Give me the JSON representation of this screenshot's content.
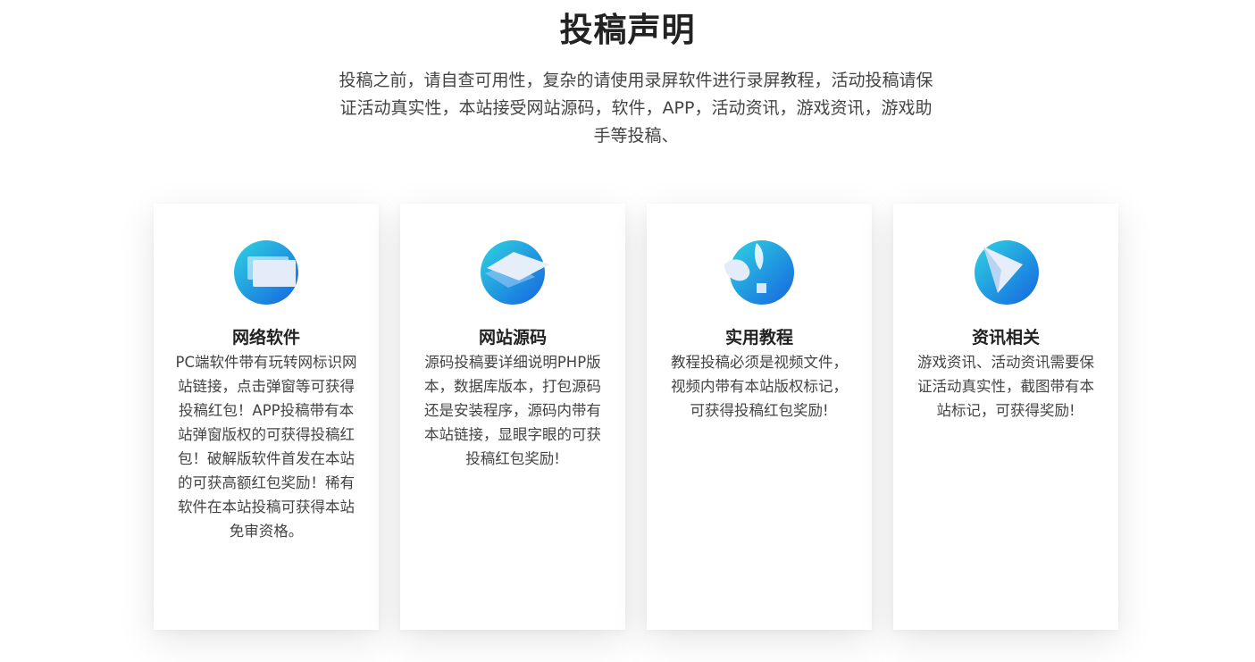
{
  "header": {
    "title": "投稿声明",
    "intro": "投稿之前，请自查可用性，复杂的请使用录屏软件进行录屏教程，活动投稿请保证活动真实性，本站接受网站源码，软件，APP，活动资讯，游戏资讯，游戏助手等投稿、"
  },
  "cards": [
    {
      "title": "网络软件",
      "description": "PC端软件带有玩转网标识网站链接，点击弹窗等可获得投稿红包！APP投稿带有本站弹窗版权的可获得投稿红包！破解版软件首发在本站的可获高额红包奖励！稀有软件在本站投稿可获得本站免审资格。",
      "icon": "window-icon"
    },
    {
      "title": "网站源码",
      "description": "源码投稿要详细说明PHP版本，数据库版本，打包源码还是安装程序，源码内带有本站链接，显眼字眼的可获投稿红包奖励!",
      "icon": "layers-icon"
    },
    {
      "title": "实用教程",
      "description": "教程投稿必须是视频文件，视频内带有本站版权标记，可获得投稿红包奖励!",
      "icon": "tutorial-icon"
    },
    {
      "title": "资讯相关",
      "description": "游戏资讯、活动资讯需要保证活动真实性，截图带有本站标记，可获得奖励!",
      "icon": "paper-plane-icon"
    }
  ],
  "colors": {
    "accent_start": "#2fd3e0",
    "accent_end": "#1565e0"
  }
}
